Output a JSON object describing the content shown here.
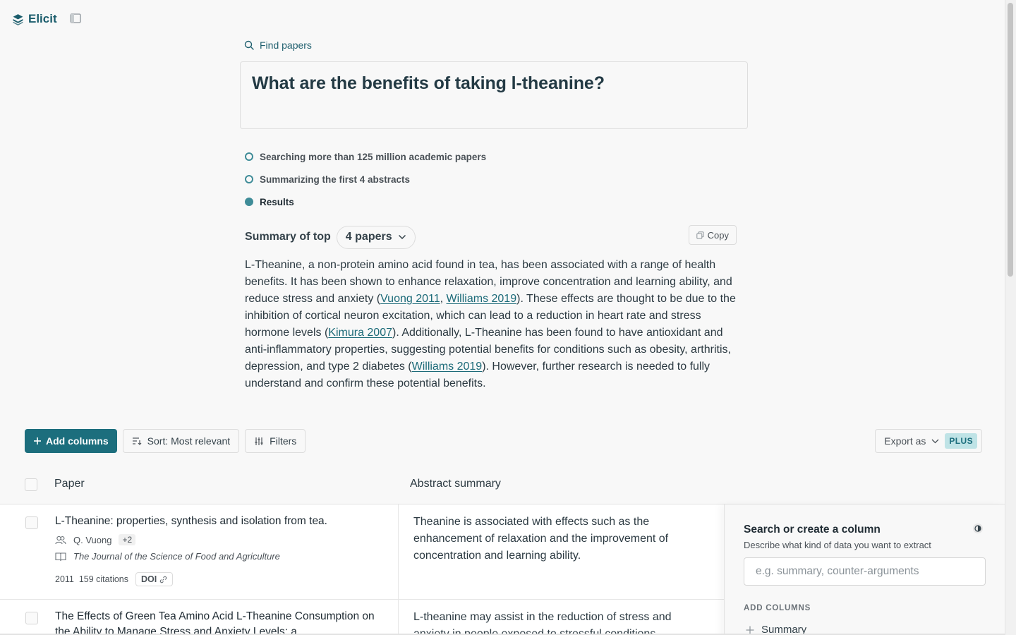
{
  "app": {
    "name": "Elicit"
  },
  "search": {
    "label": "Find papers",
    "query": "What are the benefits of taking l-theanine?"
  },
  "steps": [
    {
      "label": "Searching more than 125 million academic papers",
      "state": "done"
    },
    {
      "label": "Summarizing the first 4 abstracts",
      "state": "done"
    },
    {
      "label": "Results",
      "state": "current"
    }
  ],
  "summary": {
    "label": "Summary of top",
    "papers_select": "4 papers",
    "copy_label": "Copy",
    "segments": [
      {
        "text": "L-Theanine, a non-protein amino acid found in tea, has been associated with a range of health benefits. It has been shown to enhance relaxation, improve concentration and learning ability, and reduce stress and anxiety ("
      },
      {
        "text": "Vuong 2011",
        "cite": true
      },
      {
        "text": ", "
      },
      {
        "text": "Williams 2019",
        "cite": true
      },
      {
        "text": "). These effects are thought to be due to the inhibition of cortical neuron excitation, which can lead to a reduction in heart rate and stress hormone levels ("
      },
      {
        "text": "Kimura 2007",
        "cite": true
      },
      {
        "text": "). Additionally, L-Theanine has been found to have antioxidant and anti-inflammatory properties, suggesting potential benefits for conditions such as obesity, arthritis, depression, and type 2 diabetes ("
      },
      {
        "text": "Williams 2019",
        "cite": true
      },
      {
        "text": "). However, further research is needed to fully understand and confirm these potential benefits."
      }
    ]
  },
  "toolbar": {
    "add_columns": "Add columns",
    "sort": "Sort: Most relevant",
    "filters": "Filters",
    "export": "Export as",
    "plus_badge": "PLUS"
  },
  "table": {
    "columns": [
      "Paper",
      "Abstract summary"
    ],
    "rows": [
      {
        "title": "L-Theanine: properties, synthesis and isolation from tea.",
        "author": "Q. Vuong",
        "more_authors": "+2",
        "journal": "The Journal of the Science of Food and Agriculture",
        "year_citations": "2011  159 citations",
        "doi": "DOI",
        "abstract": "Theanine is associated with effects such as the enhancement of relaxation and the improvement of concentration and learning ability."
      },
      {
        "title": "The Effects of Green Tea Amino Acid L-Theanine Consumption on the Ability to Manage Stress and Anxiety Levels: a",
        "abstract": "L-theanine may assist in the reduction of stress and anxiety in people exposed to stressful conditions."
      }
    ]
  },
  "column_panel": {
    "title": "Search or create a column",
    "subtitle": "Describe what kind of data you want to extract",
    "placeholder": "e.g. summary, counter-arguments",
    "add_columns_label": "ADD COLUMNS",
    "first_option": "Summary"
  },
  "colors": {
    "accent": "#1c6e7d",
    "step_dot": "#3f8c98",
    "badge_bg": "#bfe3e6"
  }
}
